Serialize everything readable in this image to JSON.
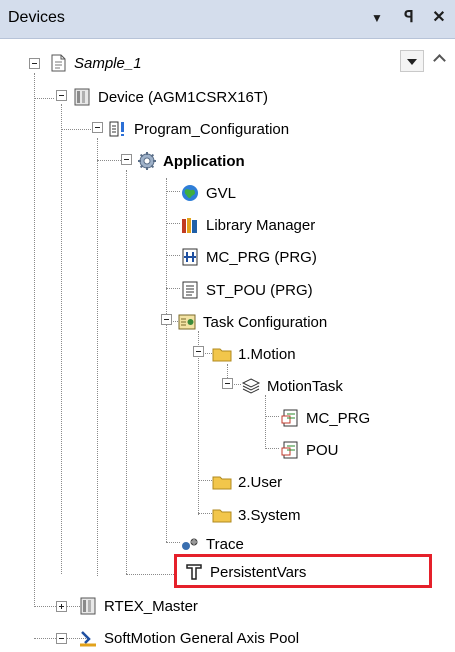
{
  "panel": {
    "title": "Devices",
    "buttons": {
      "menu": "▼",
      "pin": "ꟼ",
      "close": "✕"
    }
  },
  "tree": {
    "project": "Sample_1",
    "device": "Device (AGM1CSRX16T)",
    "program_configuration": "Program_Configuration",
    "application": "Application",
    "gvl": "GVL",
    "library_manager": "Library Manager",
    "mc_prg": "MC_PRG (PRG)",
    "st_pou": "ST_POU (PRG)",
    "task_configuration": "Task Configuration",
    "motion_folder": "1.Motion",
    "motion_task": "MotionTask",
    "motion_task_mc_prg": "MC_PRG",
    "motion_task_pou": "POU",
    "user_folder": "2.User",
    "system_folder": "3.System",
    "trace": "Trace",
    "persistent_vars": "PersistentVars",
    "rtex_master": "RTEX_Master",
    "softmotion_pool": "SoftMotion General Axis Pool"
  },
  "icons": {
    "project": "document-icon",
    "device": "device-icon",
    "program_configuration": "program-configuration-icon",
    "application": "gear-icon",
    "gvl": "globe-icon",
    "library_manager": "books-icon",
    "mc_prg": "ladder-icon",
    "st_pou": "text-document-icon",
    "task_configuration": "task-configuration-icon",
    "folder": "folder-icon",
    "motion_task": "layers-icon",
    "program_call": "program-call-icon",
    "trace": "trace-icon",
    "persistent_vars": "persistent-vars-icon",
    "softmotion_pool": "axis-pool-icon"
  },
  "colors": {
    "title_bar": "#d4ddec",
    "highlight_border": "#e5202a",
    "folder": "#f2c64b"
  }
}
